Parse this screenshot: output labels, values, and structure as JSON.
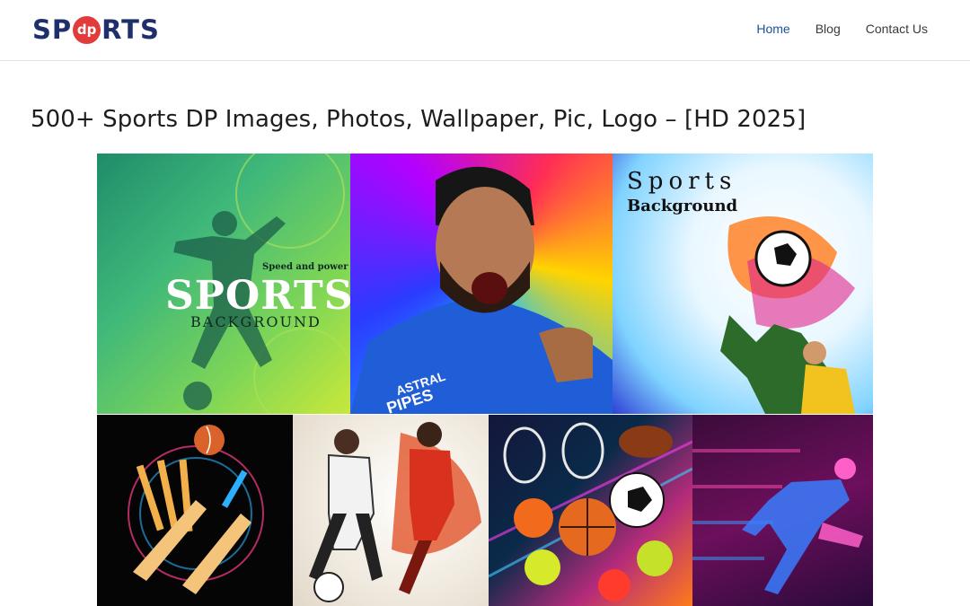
{
  "header": {
    "logo": {
      "left": "SP",
      "badge": "dp",
      "right": "RTS"
    },
    "nav": [
      {
        "label": "Home",
        "active": true
      },
      {
        "label": "Blog",
        "active": false
      },
      {
        "label": "Contact Us",
        "active": false
      }
    ],
    "accent_color": "#1e4f9c",
    "logo_color": "#1f2f6b",
    "badge_color": "#e23b3b"
  },
  "main": {
    "title": "500+ Sports DP Images, Photos, Wallpaper, Pic, Logo – [HD 2025]",
    "collage": {
      "tile1": {
        "tagline": "Speed and power",
        "headline": "SPORTS",
        "sub": "BACKGROUND"
      },
      "tile2": {
        "jersey_line1": "ASTRAL",
        "jersey_line2": "PIPES"
      },
      "tile3": {
        "headline": "Sports",
        "sub": "Background"
      }
    }
  }
}
